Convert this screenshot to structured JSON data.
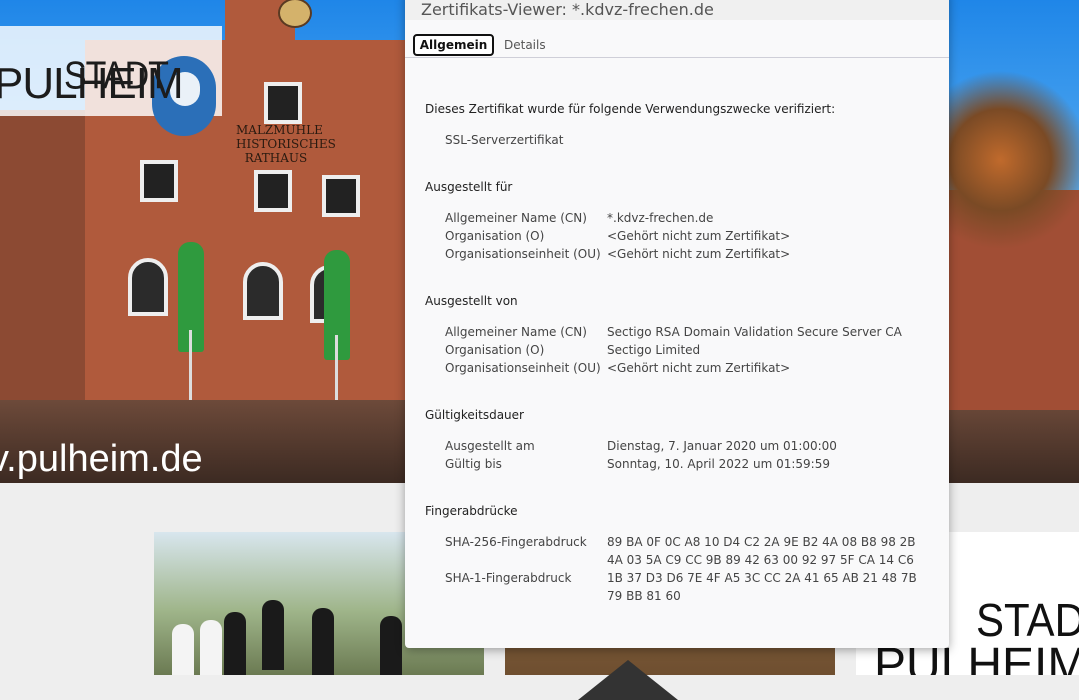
{
  "background_page": {
    "hero_url_text": "v.pulheim.de",
    "logo": {
      "line1": "STADT",
      "line2": "PULHEIM"
    },
    "building_sign": "MALZMÜHLE\nHISTORISCHES\nRATHAUS",
    "card3_logo": {
      "line1": "STADT",
      "line2": "PULHEIM"
    }
  },
  "dialog": {
    "title": "Zertifikats-Viewer: *.kdvz-frechen.de",
    "tabs": [
      {
        "label": "Allgemein",
        "active": true
      },
      {
        "label": "Details",
        "active": false
      }
    ],
    "verified_heading": "Dieses Zertifikat wurde für folgende Verwendungszwecke verifiziert:",
    "verified_usage": "SSL-Serverzertifikat",
    "issued_to": {
      "heading": "Ausgestellt für",
      "rows": [
        {
          "label": "Allgemeiner Name (CN)",
          "value": "*.kdvz-frechen.de"
        },
        {
          "label": "Organisation (O)",
          "value": "<Gehört nicht zum Zertifikat>"
        },
        {
          "label": "Organisationseinheit (OU)",
          "value": "<Gehört nicht zum Zertifikat>"
        }
      ]
    },
    "issued_by": {
      "heading": "Ausgestellt von",
      "rows": [
        {
          "label": "Allgemeiner Name (CN)",
          "value": "Sectigo RSA Domain Validation Secure Server CA"
        },
        {
          "label": "Organisation (O)",
          "value": "Sectigo Limited"
        },
        {
          "label": "Organisationseinheit (OU)",
          "value": "<Gehört nicht zum Zertifikat>"
        }
      ]
    },
    "validity": {
      "heading": "Gültigkeitsdauer",
      "rows": [
        {
          "label": "Ausgestellt am",
          "value": "Dienstag, 7. Januar 2020 um 01:00:00"
        },
        {
          "label": "Gültig bis",
          "value": "Sonntag, 10. April 2022 um 01:59:59"
        }
      ]
    },
    "fingerprints": {
      "heading": "Fingerabdrücke",
      "sha256_label": "SHA-256-Fingerabdruck",
      "sha256_line1": "89 BA 0F 0C A8 10 D4 C2 2A 9E B2 4A 08 B8 98 2B",
      "sha256_line2": "4A 03 5A C9 CC 9B 89 42 63 00 92 97 5F CA 14 C6",
      "sha1_label": "SHA-1-Fingerabdruck",
      "sha1_line1": "1B 37 D3 D6 7E 4F A5 3C CC 2A 41 65 AB 21 48 7B",
      "sha1_line2": "79 BB 81 60"
    }
  }
}
